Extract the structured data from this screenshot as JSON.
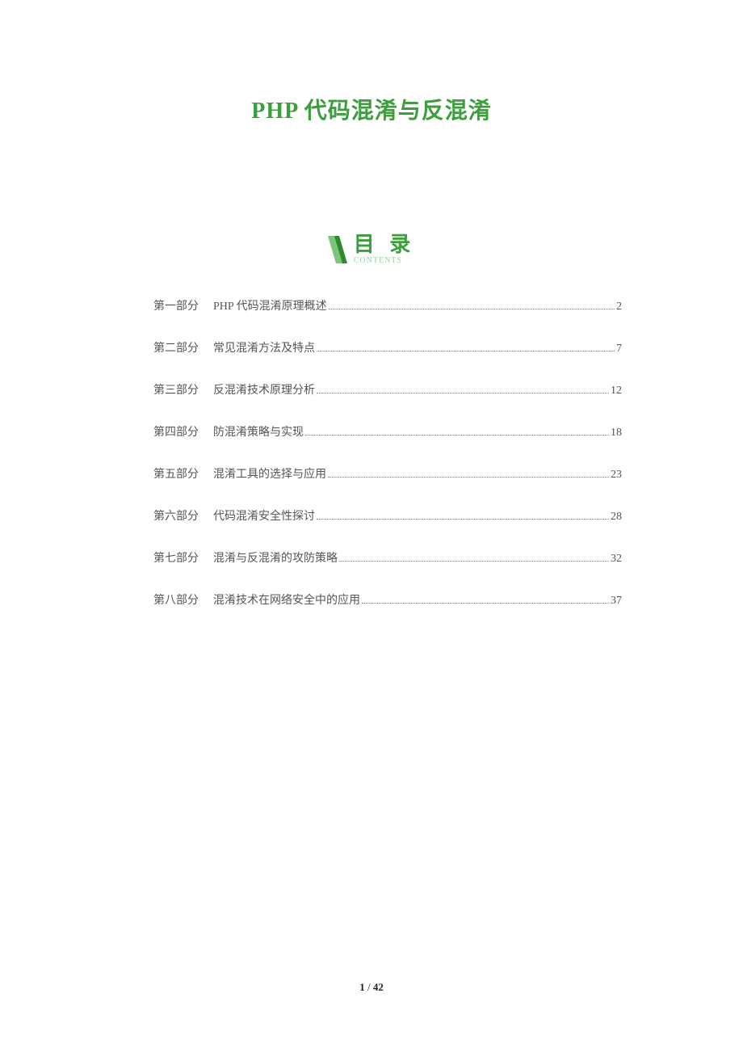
{
  "title": "PHP 代码混淆与反混淆",
  "toc_header": {
    "title": "目 录",
    "subtitle": "CONTENTS"
  },
  "toc": [
    {
      "part": "第一部分",
      "topic": "PHP 代码混淆原理概述",
      "page": "2"
    },
    {
      "part": "第二部分",
      "topic": "常见混淆方法及特点",
      "page": "7"
    },
    {
      "part": "第三部分",
      "topic": "反混淆技术原理分析",
      "page": "12"
    },
    {
      "part": "第四部分",
      "topic": "防混淆策略与实现",
      "page": "18"
    },
    {
      "part": "第五部分",
      "topic": "混淆工具的选择与应用",
      "page": "23"
    },
    {
      "part": "第六部分",
      "topic": "代码混淆安全性探讨",
      "page": "28"
    },
    {
      "part": "第七部分",
      "topic": "混淆与反混淆的攻防策略",
      "page": "32"
    },
    {
      "part": "第八部分",
      "topic": "混淆技术在网络安全中的应用",
      "page": "37"
    }
  ],
  "footer": {
    "current": "1",
    "sep": " / ",
    "total": "42"
  }
}
